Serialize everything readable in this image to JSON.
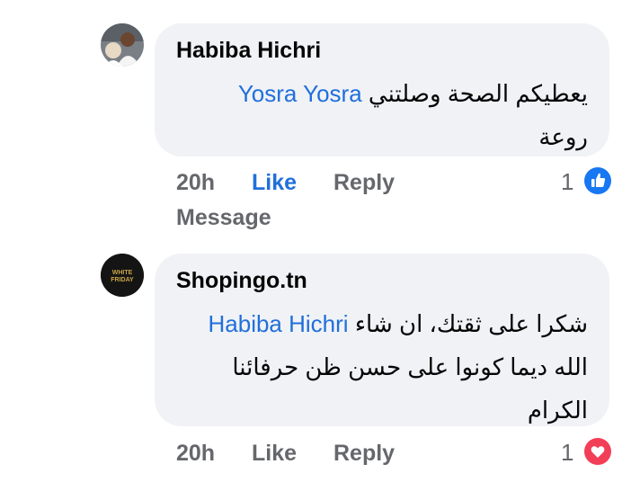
{
  "comments": [
    {
      "author": "Habiba Hichri",
      "mention": "Yosra Yosra",
      "text_line1": "يعطيكم الصحة وصلتني",
      "text_line2": "روعة",
      "time": "20h",
      "like_label": "Like",
      "reply_label": "Reply",
      "message_label": "Message",
      "reaction_count": "1",
      "reaction": "like-reaction-icon",
      "liked_by_viewer": true
    },
    {
      "author": "Shopingo.tn",
      "avatar_text": [
        "WHITE",
        "FRIDAY"
      ],
      "mention": "Habiba Hichri",
      "text_line1": "شكرا على ثقتك، ان شاء",
      "text_line2": "الله ديما كونوا على حسن ظن حرفائنا",
      "text_line3": "الكرام",
      "time": "20h",
      "like_label": "Like",
      "reply_label": "Reply",
      "reaction_count": "1",
      "reaction": "love-reaction-icon",
      "liked_by_viewer": false
    }
  ],
  "colors": {
    "link": "#216fdb",
    "bubble": "#f0f2f5",
    "meta": "#65676b",
    "like_reaction": "#1877f2",
    "love_reaction": "#f33e58"
  }
}
